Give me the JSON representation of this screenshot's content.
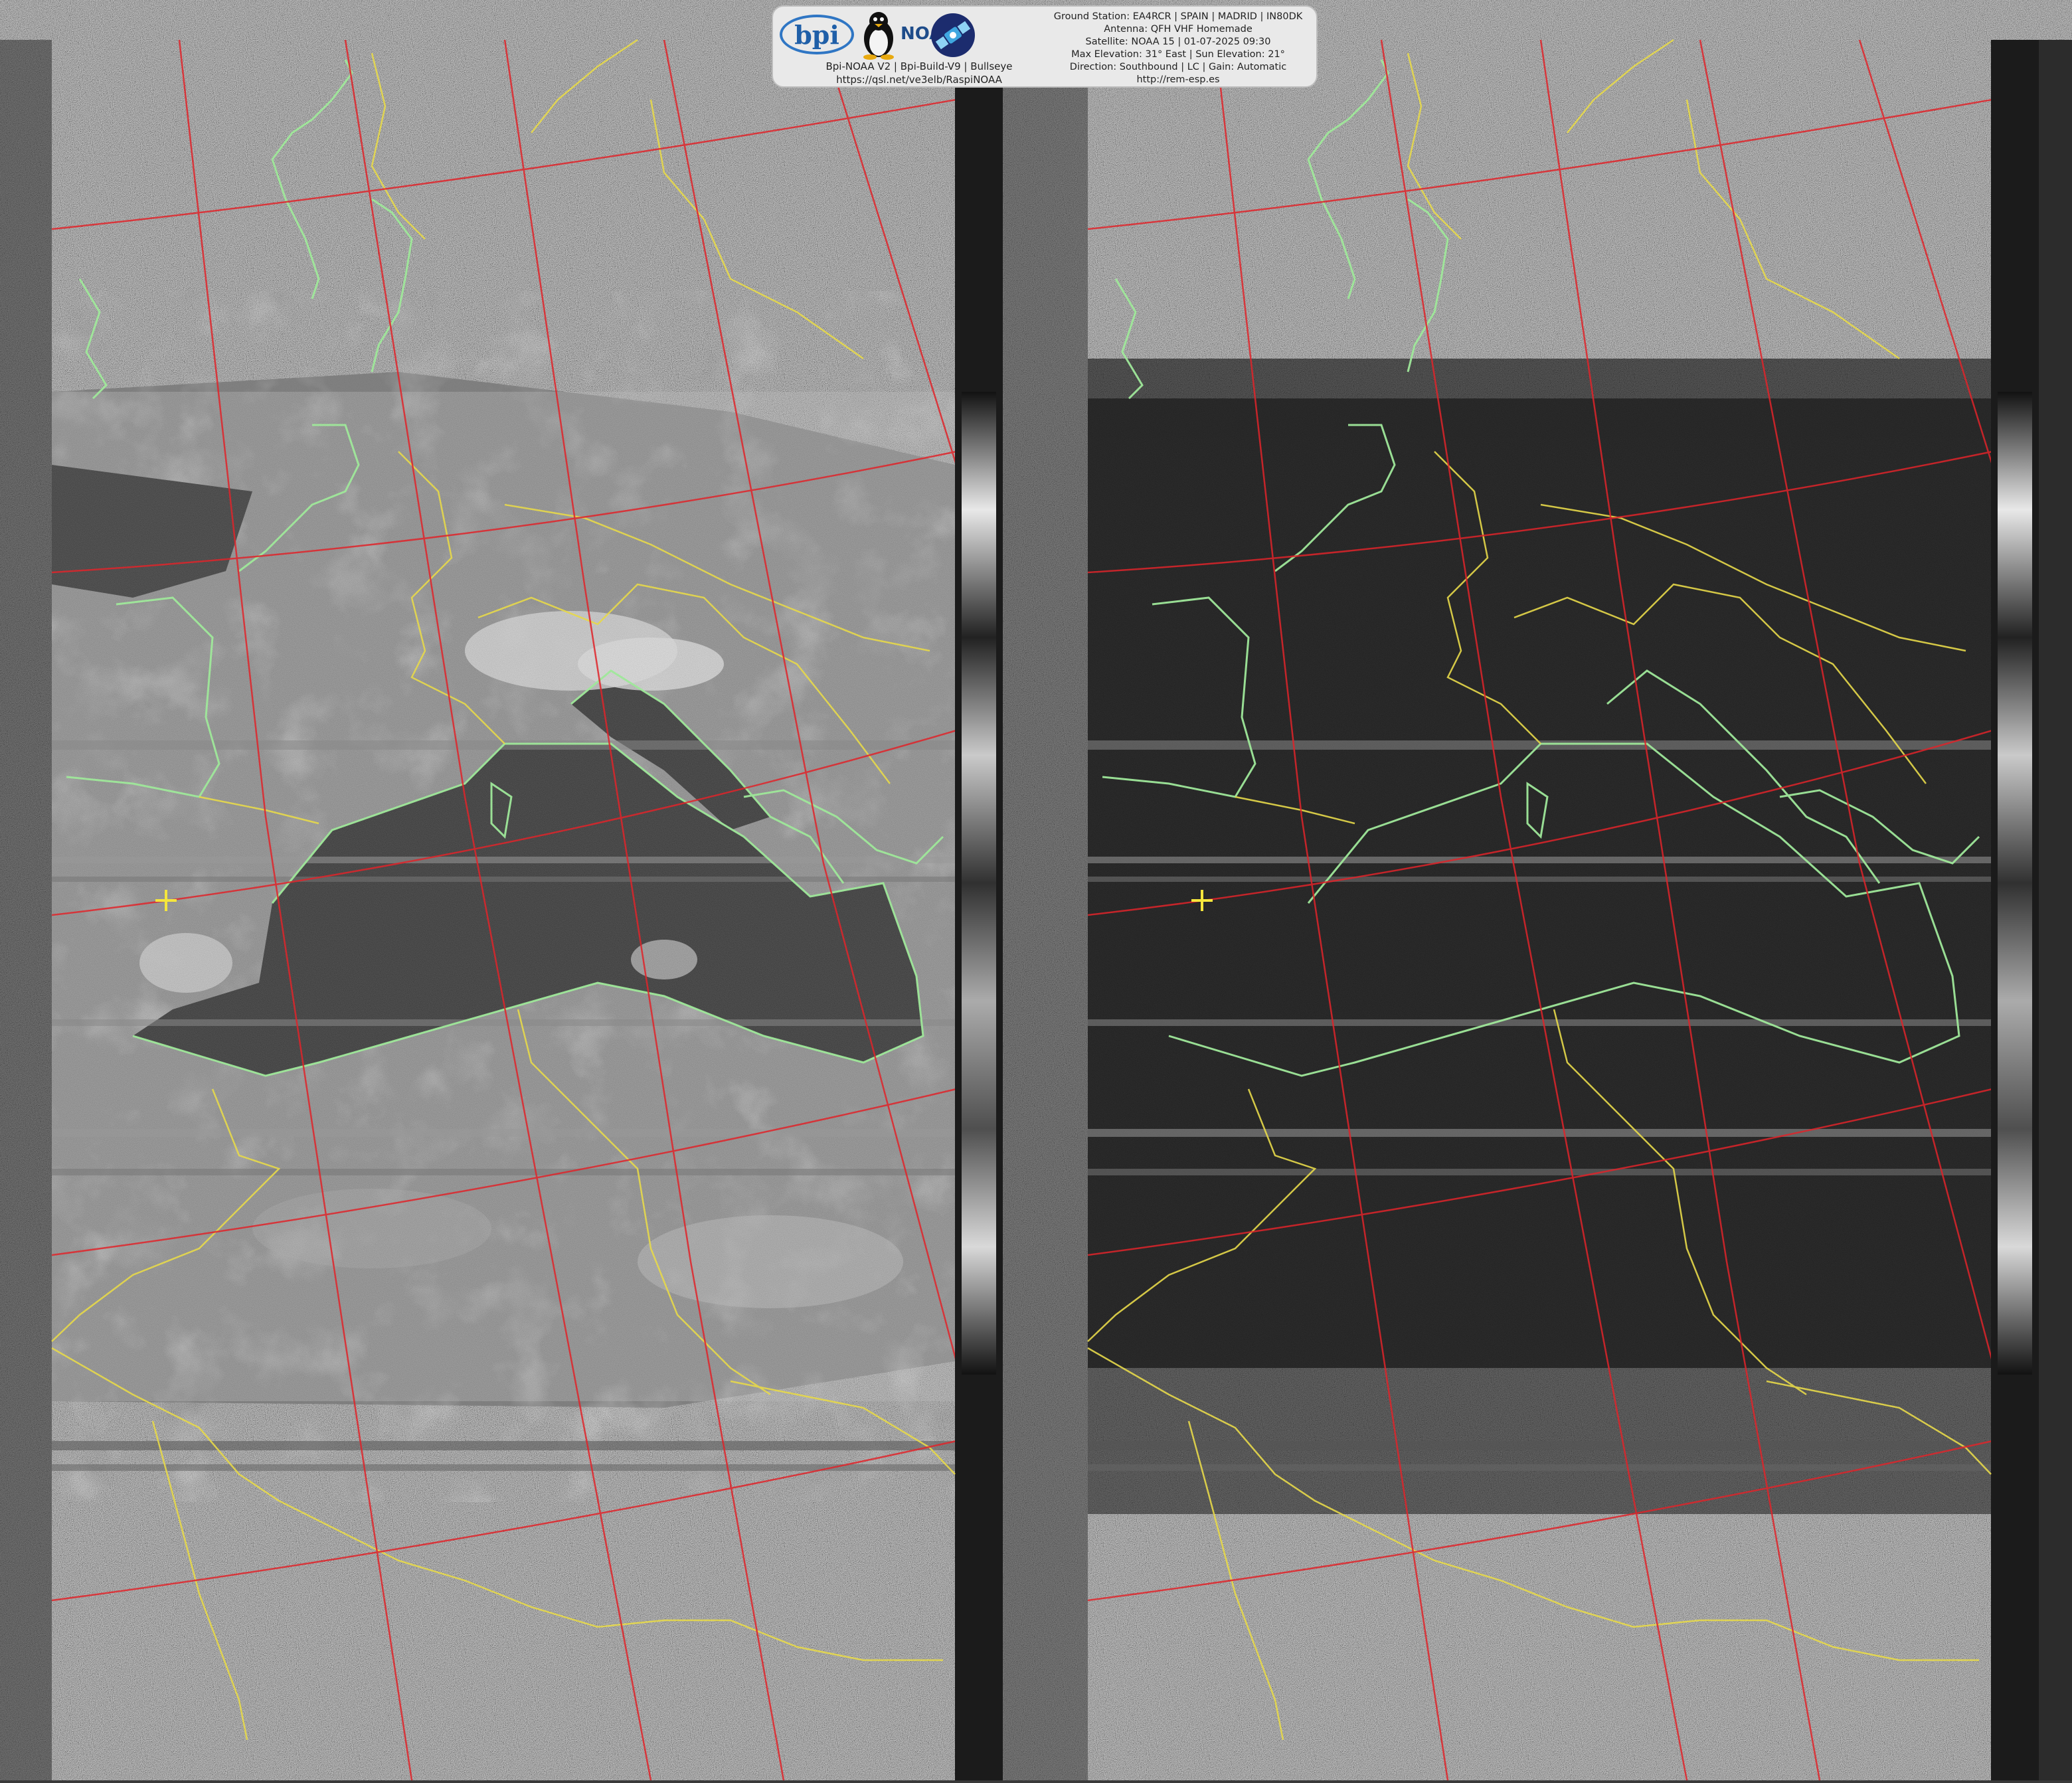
{
  "header": {
    "logo_bpi_text": "bpi",
    "logo_noaa_text": "NOAA",
    "caption_line1": "Bpi-NOAA V2 | Bpi-Build-V9 | Bullseye",
    "caption_line2": "https://qsl.net/ve3elb/RaspiNOAA",
    "station_lines": [
      "Ground Station: EA4RCR | SPAIN | MADRID | IN80DK",
      "Antenna: QFH VHF Homemade",
      "Satellite: NOAA 15 | 01-07-2025 09:30",
      "Max Elevation: 31° East | Sun Elevation: 21°",
      "Direction: Southbound | LC | Gain: Automatic",
      "http://rem-esp.es"
    ]
  },
  "colors": {
    "background": "#3a3a3a",
    "grid_line": "#e0242a",
    "border_line": "#e7d94a",
    "coast_line": "#9fe89a",
    "station_marker": "#f5e63c",
    "sea": "#0c0c0c",
    "land_visible": "#8a8a8a",
    "cloud": "#d9d9d9"
  },
  "images": {
    "left_channel": "visible-channel",
    "right_channel": "infrared-channel"
  },
  "icons": [
    "bpi-logo-icon",
    "tux-penguin-icon",
    "noaa-logo-icon",
    "satellite-badge-icon",
    "station-marker-icon"
  ]
}
